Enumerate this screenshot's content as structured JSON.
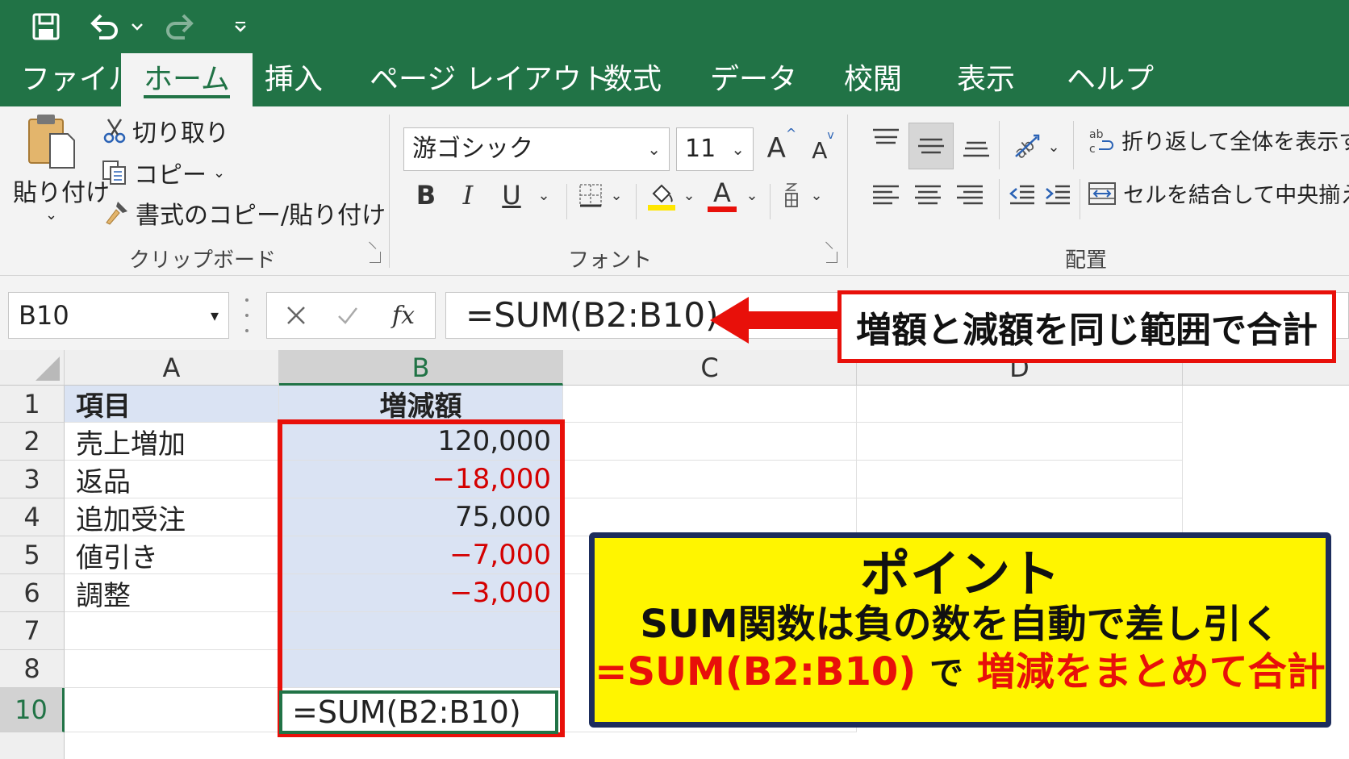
{
  "quick_access": {
    "save_icon": "save-icon",
    "undo_icon": "undo-icon",
    "redo_icon": "redo-icon",
    "customize_icon": "customize-icon"
  },
  "tabs": [
    {
      "label": "ファイル",
      "active": false
    },
    {
      "label": "ホーム",
      "active": true
    },
    {
      "label": "挿入",
      "active": false
    },
    {
      "label": "ページ レイアウト",
      "active": false
    },
    {
      "label": "数式",
      "active": false
    },
    {
      "label": "データ",
      "active": false
    },
    {
      "label": "校閲",
      "active": false
    },
    {
      "label": "表示",
      "active": false
    },
    {
      "label": "ヘルプ",
      "active": false
    }
  ],
  "ribbon": {
    "clipboard": {
      "paste": "貼り付け",
      "cut": "切り取り",
      "copy": "コピー",
      "format_painter": "書式のコピー/貼り付け",
      "group_label": "クリップボード"
    },
    "font": {
      "font_name": "游ゴシック",
      "font_size": "11",
      "bold": "B",
      "italic": "I",
      "underline": "U",
      "font_color_letter": "A",
      "grow_letter": "A",
      "shrink_letter": "A",
      "group_label": "フォント",
      "highlight_color": "#ffe600",
      "font_color": "#e8100a"
    },
    "alignment": {
      "wrap_text": "折り返して全体を表示する",
      "merge_center": "セルを結合して中央揃え",
      "group_label": "配置"
    }
  },
  "formula_bar": {
    "name_box": "B10",
    "fx": "fx",
    "formula": "=SUM(B2:B10)"
  },
  "sheet": {
    "columns": [
      "A",
      "B",
      "C",
      "D"
    ],
    "selected_column": "B",
    "rows": [
      {
        "num": "1",
        "a": "項目",
        "b": "増減額",
        "header": true
      },
      {
        "num": "2",
        "a": "売上増加",
        "b": "120,000",
        "negative": false
      },
      {
        "num": "3",
        "a": "返品",
        "b": "−18,000",
        "negative": true
      },
      {
        "num": "4",
        "a": "追加受注",
        "b": "75,000",
        "negative": false
      },
      {
        "num": "5",
        "a": "値引き",
        "b": "−7,000",
        "negative": true
      },
      {
        "num": "6",
        "a": "調整",
        "b": "−3,000",
        "negative": true
      },
      {
        "num": "7",
        "a": "",
        "b": ""
      },
      {
        "num": "8",
        "a": "",
        "b": ""
      },
      {
        "num": "10",
        "a": "",
        "b": ""
      }
    ],
    "active_cell_value": "=SUM(B2:B10)"
  },
  "callouts": {
    "top": "増額と減額を同じ範囲で合計",
    "point_title": "ポイント",
    "point_line2": "SUM関数は負の数を自動で差し引く",
    "point_formula": "=SUM(B2:B10)",
    "point_de": "で",
    "point_rest": "増減をまとめて合計"
  },
  "colors": {
    "excel_green": "#217346",
    "header_fill": "#dae3f3",
    "negative": "#d40000",
    "callout_red": "#e8100a",
    "point_yellow": "#fff500"
  }
}
